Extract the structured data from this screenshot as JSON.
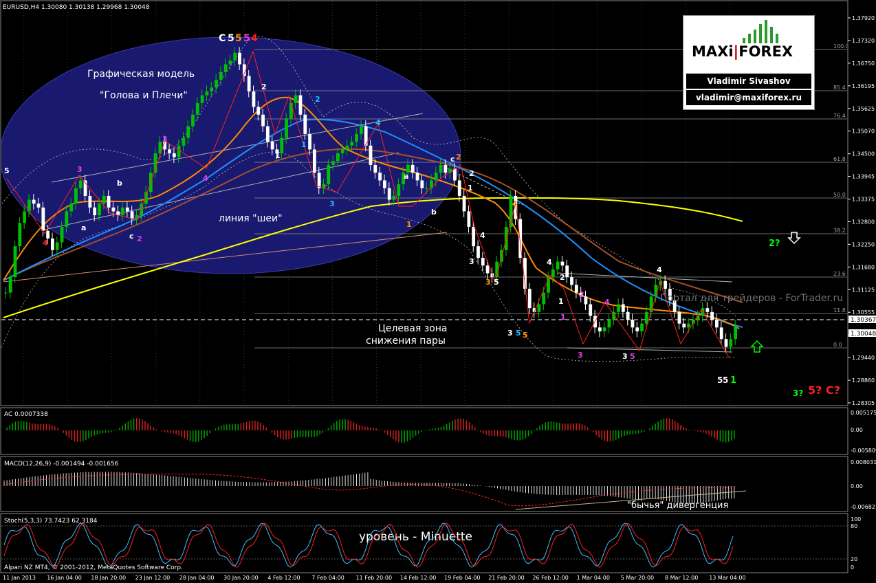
{
  "symbol_header": "EURUSD,H4  1.30080 1.30138 1.29968 1.30048",
  "price_ticks": [
    "1.37920",
    "1.37320",
    "1.36750",
    "1.36195",
    "1.35625",
    "1.35070",
    "1.34500",
    "1.33945",
    "1.33375",
    "1.32800",
    "1.32250",
    "1.31680",
    "1.31125",
    "1.30555",
    "1.30048",
    "1.29440",
    "1.28860",
    "1.28305"
  ],
  "price_labels": {
    "last": "1.30048",
    "line": "1.30367"
  },
  "fib_levels": [
    "100.0",
    "85.4",
    "76.4",
    "61.8",
    "50.0",
    "38.2",
    "23.6",
    "11.8",
    "0.0"
  ],
  "time_ticks": [
    "11 Jan 2013",
    "16 Jan 04:00",
    "18 Jan 20:00",
    "23 Jan 12:00",
    "28 Jan 04:00",
    "30 Jan 20:00",
    "4 Feb 12:00",
    "7 Feb 04:00",
    "11 Feb 20:00",
    "14 Feb 12:00",
    "19 Feb 04:00",
    "21 Feb 20:00",
    "26 Feb 12:00",
    "1 Mar 04:00",
    "5 Mar 20:00",
    "8 Mar 12:00",
    "13 Mar 04:00"
  ],
  "annotations": {
    "hs_model_1": "Графическая модель",
    "hs_model_2": "\"Голова и Плечи\"",
    "neckline": "линия \"шеи\"",
    "target_1": "Целевая зона",
    "target_2": "снижения пары",
    "divergence": "\"бычья\" дивергенция",
    "level": "уровень - Minuette",
    "watermark": "Портал для трейдеров - ForTrader.ru",
    "copyright": "Alpari NZ MT4, © 2001-2012, MetaQuotes Software Corp."
  },
  "wave_labels": {
    "top": [
      "C",
      "5",
      "5",
      "5",
      "4"
    ],
    "question_2": "2?",
    "question_3": "3?",
    "question_5": "5?",
    "question_c": "C?"
  },
  "logo": {
    "brand_left": "MAXi",
    "brand_right": "FOREX",
    "name": "Vladimir Sivashov",
    "email": "vladimir@maxiforex.ru"
  },
  "indicators": {
    "ac": {
      "label": "AC 0.0007338",
      "ticks": [
        "0.005175",
        "0.00",
        "-0.005809"
      ]
    },
    "macd": {
      "label": "MACD(12,26,9) -0.001494 -0.001656",
      "ticks": [
        "0.008031",
        "0.00",
        "-0.006821"
      ]
    },
    "stoch": {
      "label": "Stoch(5,3,3) 73.7423 62.3184",
      "ticks": [
        "100",
        "80",
        "20",
        "0"
      ]
    }
  },
  "colors": {
    "ellipse": "#191970",
    "ma_orange": "#ff8c00",
    "ma_blue": "#1e90ff",
    "ma_brown": "#a0522d",
    "ma_yellow": "#ffff00",
    "bull": "#00c000",
    "bear": "#ffffff",
    "red": "#ff2020",
    "magenta": "#e040e0",
    "cyan": "#20c0ff",
    "green": "#00ff00"
  },
  "chart_data": {
    "type": "candlestick",
    "title": "EURUSD,H4",
    "ylim": [
      1.283,
      1.38
    ],
    "close": [
      1.309,
      1.313,
      1.321,
      1.327,
      1.33,
      1.333,
      1.332,
      1.331,
      1.325,
      1.323,
      1.32,
      1.322,
      1.326,
      1.33,
      1.332,
      1.336,
      1.338,
      1.334,
      1.331,
      1.329,
      1.332,
      1.334,
      1.331,
      1.33,
      1.329,
      1.331,
      1.33,
      1.328,
      1.329,
      1.332,
      1.335,
      1.34,
      1.345,
      1.348,
      1.346,
      1.345,
      1.344,
      1.347,
      1.349,
      1.352,
      1.355,
      1.358,
      1.36,
      1.361,
      1.362,
      1.364,
      1.366,
      1.368,
      1.369,
      1.371,
      1.368,
      1.365,
      1.361,
      1.357,
      1.355,
      1.352,
      1.348,
      1.346,
      1.345,
      1.349,
      1.354,
      1.358,
      1.36,
      1.355,
      1.35,
      1.346,
      1.34,
      1.336,
      1.337,
      1.342,
      1.343,
      1.345,
      1.346,
      1.347,
      1.348,
      1.35,
      1.352,
      1.347,
      1.342,
      1.34,
      1.338,
      1.336,
      1.333,
      1.334,
      1.337,
      1.34,
      1.342,
      1.34,
      1.338,
      1.336,
      1.336,
      1.338,
      1.34,
      1.342,
      1.34,
      1.341,
      1.338,
      1.334,
      1.33,
      1.326,
      1.321,
      1.318,
      1.316,
      1.314,
      1.313,
      1.317,
      1.32,
      1.326,
      1.334,
      1.328,
      1.318,
      1.31,
      1.305,
      1.304,
      1.306,
      1.309,
      1.313,
      1.315,
      1.317,
      1.316,
      1.313,
      1.311,
      1.309,
      1.308,
      1.306,
      1.303,
      1.3,
      1.299,
      1.3,
      1.302,
      1.304,
      1.306,
      1.304,
      1.302,
      1.3,
      1.299,
      1.301,
      1.304,
      1.308,
      1.311,
      1.312,
      1.31,
      1.307,
      1.304,
      1.301,
      1.3,
      1.301,
      1.302,
      1.303,
      1.305,
      1.304,
      1.302,
      1.3,
      1.297,
      1.295,
      1.297,
      1.3005
    ]
  }
}
